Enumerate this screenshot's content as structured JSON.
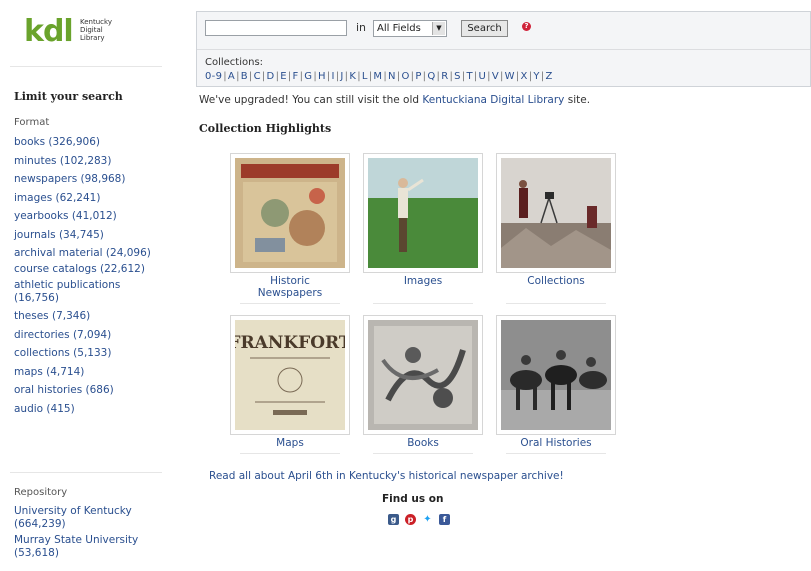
{
  "logo": {
    "text": "kdl",
    "subtitle_lines": [
      "Kentucky",
      "Digital",
      "Library"
    ]
  },
  "sidebar": {
    "title": "Limit your search",
    "format_heading": "Format",
    "format_items": [
      "books (326,906)",
      "minutes (102,283)",
      "newspapers (98,968)",
      "images (62,241)",
      "yearbooks (41,012)",
      "journals (34,745)",
      "archival material (24,096)",
      "course catalogs (22,612)",
      "athletic publications (16,756)",
      "theses (7,346)",
      "directories (7,094)",
      "collections (5,133)",
      "maps (4,714)",
      "oral histories (686)",
      "audio (415)"
    ],
    "repository_heading": "Repository",
    "repository_items": [
      "University of Kentucky (664,239)",
      "Murray State University (53,618)"
    ]
  },
  "search": {
    "input_value": "",
    "in_label": "in",
    "field_selected": "All Fields",
    "button_label": "Search",
    "help_glyph": "?",
    "collections_label": "Collections:",
    "alpha_links": [
      "0-9",
      "A",
      "B",
      "C",
      "D",
      "E",
      "F",
      "G",
      "H",
      "I",
      "J",
      "K",
      "L",
      "M",
      "N",
      "O",
      "P",
      "Q",
      "R",
      "S",
      "T",
      "U",
      "V",
      "W",
      "X",
      "Y",
      "Z"
    ]
  },
  "notice": {
    "prefix": "We've upgraded! You can still visit the old ",
    "link": "Kentuckiana Digital Library",
    "suffix": " site."
  },
  "highlights": {
    "title": "Collection Highlights",
    "tiles": [
      {
        "caption": "Historic Newspapers"
      },
      {
        "caption": "Images"
      },
      {
        "caption": "Collections"
      },
      {
        "caption": "Maps"
      },
      {
        "caption": "Books"
      },
      {
        "caption": "Oral Histories"
      }
    ],
    "map_title_text": "FRANKFORT"
  },
  "footer": {
    "read_about": "Read all about April 6th in Kentucky's historical newspaper archive!",
    "find_us": "Find us on",
    "social_icons": [
      "google-plus-icon",
      "pinterest-icon",
      "twitter-icon",
      "facebook-icon"
    ]
  },
  "colors": {
    "brand_green": "#6aa32c",
    "link_blue": "#2a4f8f",
    "help_red": "#d0233a"
  }
}
